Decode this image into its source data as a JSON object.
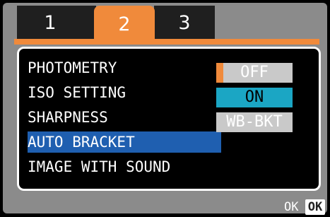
{
  "tabs": [
    {
      "label": "1"
    },
    {
      "label": "2"
    },
    {
      "label": "3"
    }
  ],
  "menu": {
    "items": [
      {
        "label": "PHOTOMETRY"
      },
      {
        "label": "ISO SETTING"
      },
      {
        "label": "SHARPNESS"
      },
      {
        "label": "AUTO BRACKET"
      },
      {
        "label": "IMAGE WITH SOUND"
      }
    ],
    "selected_item": "AUTO BRACKET"
  },
  "options": {
    "items": [
      {
        "label": "OFF"
      },
      {
        "label": "ON"
      },
      {
        "label": "WB-BKT"
      }
    ],
    "highlighted": "ON"
  },
  "footer": {
    "ok_text": "OK",
    "ok_button": "OK"
  },
  "colors": {
    "accent": "#f08a3b",
    "selection": "#1f5fb0",
    "option_highlight": "#1ba6c4",
    "frame": "#8b8b8b"
  }
}
